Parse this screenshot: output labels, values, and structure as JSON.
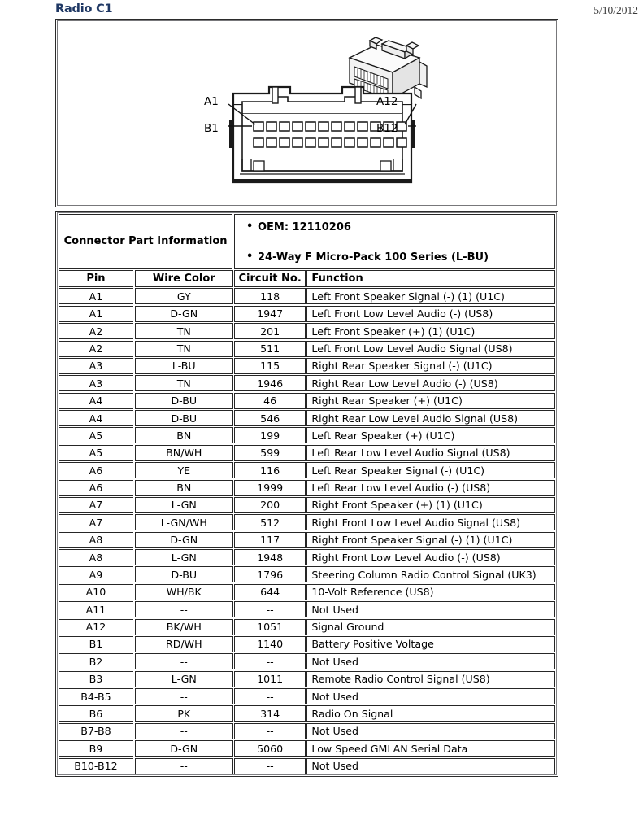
{
  "header": {
    "title": "Radio C1",
    "date": "5/10/2012"
  },
  "diagram": {
    "name": "connector-face-view",
    "labels": {
      "a1": "A1",
      "b1": "B1",
      "a12": "A12",
      "b12": "B12"
    },
    "rows": 2,
    "pins_per_row": 12
  },
  "connector_part_information": {
    "label": "Connector Part Information",
    "oem": "OEM: 12110206",
    "ways": "24-Way F Micro-Pack 100 Series (L-BU)"
  },
  "table": {
    "columns": [
      "Pin",
      "Wire Color",
      "Circuit No.",
      "Function"
    ],
    "rows": [
      [
        "A1",
        "GY",
        "118",
        "Left Front Speaker Signal (-) (1) (U1C)"
      ],
      [
        "A1",
        "D-GN",
        "1947",
        "Left Front Low Level Audio (-) (US8)"
      ],
      [
        "A2",
        "TN",
        "201",
        "Left Front Speaker (+) (1) (U1C)"
      ],
      [
        "A2",
        "TN",
        "511",
        "Left Front Low Level Audio Signal (US8)"
      ],
      [
        "A3",
        "L-BU",
        "115",
        "Right Rear Speaker Signal (-) (U1C)"
      ],
      [
        "A3",
        "TN",
        "1946",
        "Right Rear Low Level Audio (-) (US8)"
      ],
      [
        "A4",
        "D-BU",
        "46",
        "Right Rear Speaker (+) (U1C)"
      ],
      [
        "A4",
        "D-BU",
        "546",
        "Right Rear Low Level Audio Signal (US8)"
      ],
      [
        "A5",
        "BN",
        "199",
        "Left Rear Speaker (+) (U1C)"
      ],
      [
        "A5",
        "BN/WH",
        "599",
        "Left Rear Low Level Audio Signal (US8)"
      ],
      [
        "A6",
        "YE",
        "116",
        "Left Rear Speaker Signal (-) (U1C)"
      ],
      [
        "A6",
        "BN",
        "1999",
        "Left Rear Low Level Audio (-) (US8)"
      ],
      [
        "A7",
        "L-GN",
        "200",
        "Right Front Speaker (+) (1) (U1C)"
      ],
      [
        "A7",
        "L-GN/WH",
        "512",
        "Right Front Low Level Audio Signal (US8)"
      ],
      [
        "A8",
        "D-GN",
        "117",
        "Right Front Speaker Signal (-) (1) (U1C)"
      ],
      [
        "A8",
        "L-GN",
        "1948",
        "Right Front Low Level Audio (-) (US8)"
      ],
      [
        "A9",
        "D-BU",
        "1796",
        "Steering Column Radio Control Signal (UK3)"
      ],
      [
        "A10",
        "WH/BK",
        "644",
        "10-Volt Reference (US8)"
      ],
      [
        "A11",
        "--",
        "--",
        "Not Used"
      ],
      [
        "A12",
        "BK/WH",
        "1051",
        "Signal Ground"
      ],
      [
        "B1",
        "RD/WH",
        "1140",
        "Battery Positive Voltage"
      ],
      [
        "B2",
        "--",
        "--",
        "Not Used"
      ],
      [
        "B3",
        "L-GN",
        "1011",
        "Remote Radio Control Signal (US8)"
      ],
      [
        "B4-B5",
        "--",
        "--",
        "Not Used"
      ],
      [
        "B6",
        "PK",
        "314",
        "Radio On Signal"
      ],
      [
        "B7-B8",
        "--",
        "--",
        "Not Used"
      ],
      [
        "B9",
        "D-GN",
        "5060",
        "Low Speed GMLAN Serial Data"
      ],
      [
        "B10-B12",
        "--",
        "--",
        "Not Used"
      ]
    ]
  },
  "colors": {
    "title": "#1f3864",
    "border": "#262626",
    "text": "#000000"
  }
}
